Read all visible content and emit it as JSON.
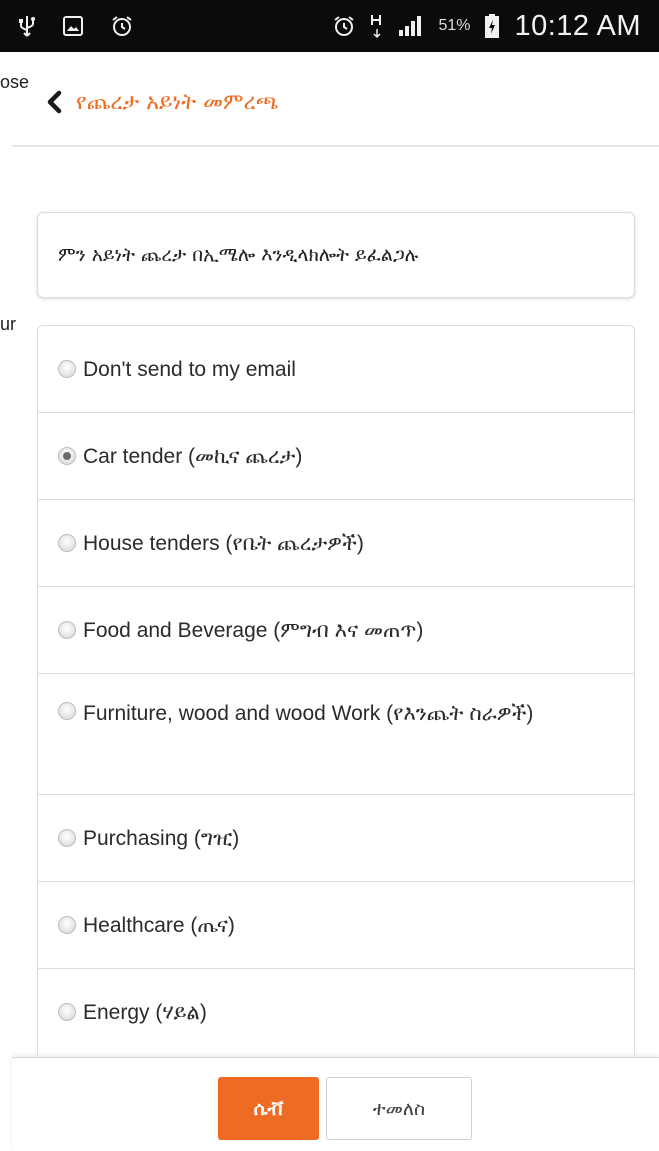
{
  "status_bar": {
    "battery": "51%",
    "time": "10:12 AM",
    "icons": [
      "usb-icon",
      "image-icon",
      "alarm-icon",
      "alarm-icon",
      "hplus-icon",
      "signal-icon",
      "battery-icon"
    ]
  },
  "side_fragments": {
    "top": "ose",
    "middle": "ur"
  },
  "header": {
    "title": "የጨረታ አይነት መምረጫ"
  },
  "question": "ምን አይነት ጨረታ በኢሜሎ እንዲላክሎት ይፈልጋሉ",
  "options": [
    {
      "label": "Don't send to my email",
      "checked": false
    },
    {
      "label": "Car tender (መኪና ጨረታ)",
      "checked": true
    },
    {
      "label": "House tenders (የቤት ጨረታዎች)",
      "checked": false
    },
    {
      "label": "Food and Beverage (ምግብ እና መጠጥ)",
      "checked": false
    },
    {
      "label": "Furniture, wood and wood Work (የእንጨት ስራዎች)",
      "checked": false
    },
    {
      "label": "Purchasing (ግዢ)",
      "checked": false
    },
    {
      "label": "Healthcare (ጤና)",
      "checked": false
    },
    {
      "label": "Energy (ሃይል)",
      "checked": false
    }
  ],
  "footer": {
    "next_label": "ሴቭ",
    "back_label": "ተመለስ"
  },
  "colors": {
    "accent": "#ee6b23",
    "title": "#ef6c22",
    "status_bar": "#0b0b0b"
  }
}
